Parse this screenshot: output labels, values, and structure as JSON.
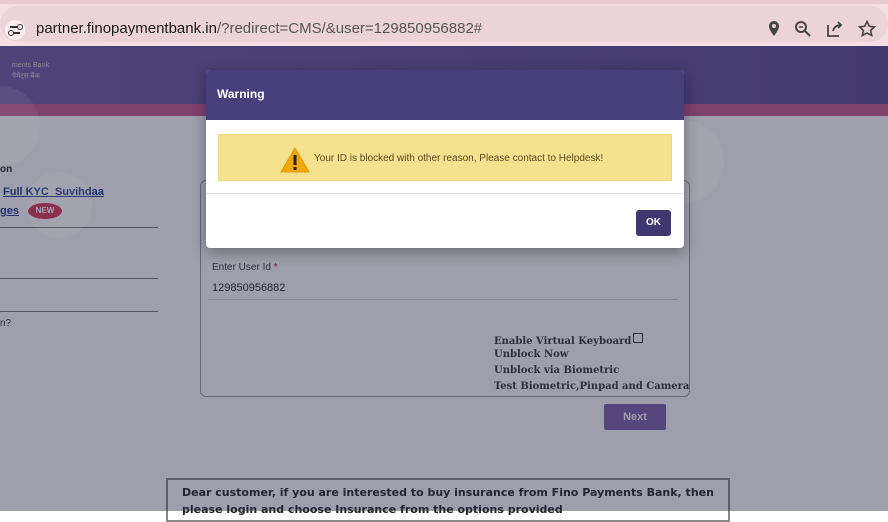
{
  "browser": {
    "url_host": "partner.finopaymentbank.in",
    "url_path": "/?redirect=CMS/&user=129850956882#",
    "icons": [
      "site-info-icon",
      "location-icon",
      "zoom-icon",
      "share-icon",
      "bookmark-star-icon"
    ]
  },
  "page": {
    "logo_line1": "ments Bank",
    "logo_line2": "पेमेंट्स बैंक",
    "left_heading": "on",
    "left_link1": "Full KYC_Suvihdaa",
    "left_link2": "ges",
    "new_badge": "NEW",
    "left_text3": "n?",
    "user_id_label": "Enter User Id",
    "user_id_required": "*",
    "user_id_value": "129850956882",
    "option_virtual_keyboard": "Enable Virtual Keyboard",
    "option_unblock_now": "Unblock Now",
    "option_unblock_biometric": "Unblock via Biometric",
    "option_test_biometric": "Test Biometric,Pinpad and Camera",
    "next_button": "Next",
    "notice_text": "Dear customer, if you are interested to buy insurance from Fino Payments Bank, then please login and choose Insurance from the options provided"
  },
  "modal": {
    "title": "Warning",
    "message": "Your ID is blocked with other reason, Please contact to Helpdesk!",
    "ok_button": "OK",
    "alert_color": "#f4e28f",
    "header_color": "#473e7c"
  }
}
